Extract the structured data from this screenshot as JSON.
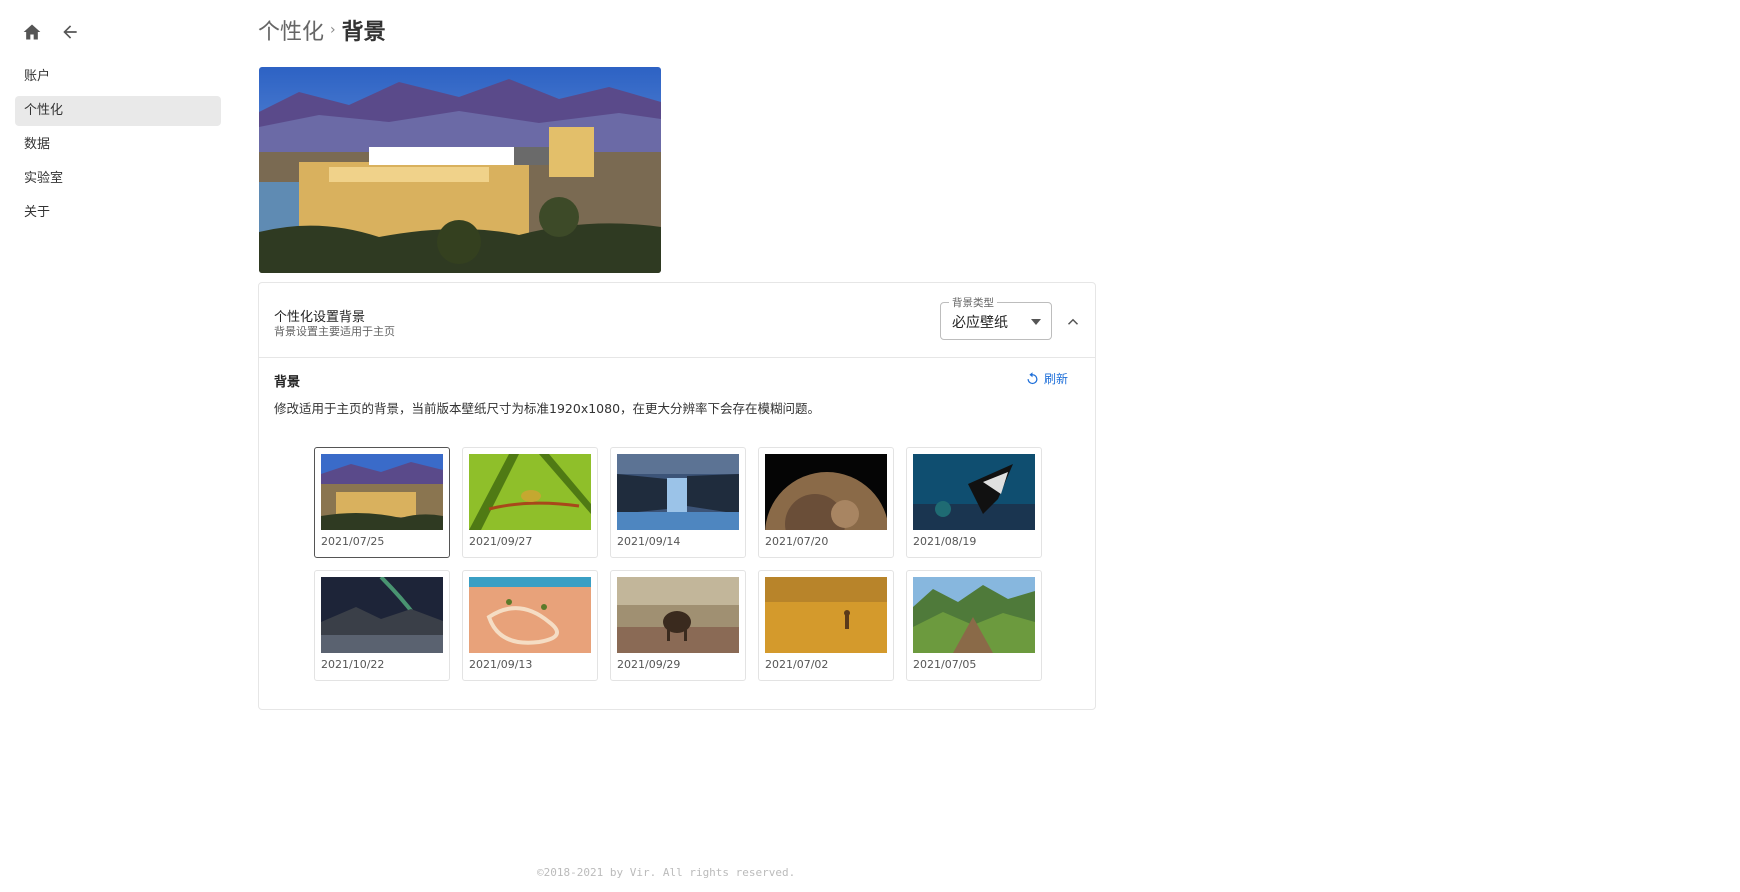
{
  "sidebar": {
    "icons": [
      "home-icon",
      "arrow-left-icon"
    ],
    "items": [
      {
        "label": "账户",
        "active": false
      },
      {
        "label": "个性化",
        "active": true
      },
      {
        "label": "数据",
        "active": false
      },
      {
        "label": "实验室",
        "active": false
      },
      {
        "label": "关于",
        "active": false
      }
    ]
  },
  "breadcrumb": {
    "parent": "个性化",
    "separator": "›",
    "current": "背景"
  },
  "settings": {
    "title": "个性化设置背景",
    "subtitle": "背景设置主要适用于主页",
    "select": {
      "label": "背景类型",
      "value": "必应壁纸"
    },
    "collapse_icon": "chevron-up-icon"
  },
  "background": {
    "title": "背景",
    "refresh_label": "刷新",
    "refresh_icon": "refresh-icon",
    "description": "修改适用于主页的背景，当前版本壁纸尺寸为标准1920x1080，在更大分辨率下会存在模糊问题。"
  },
  "thumbnails": [
    {
      "date": "2021/07/25",
      "selected": true
    },
    {
      "date": "2021/09/27",
      "selected": false
    },
    {
      "date": "2021/09/14",
      "selected": false
    },
    {
      "date": "2021/07/20",
      "selected": false
    },
    {
      "date": "2021/08/19",
      "selected": false
    },
    {
      "date": "2021/10/22",
      "selected": false
    },
    {
      "date": "2021/09/13",
      "selected": false
    },
    {
      "date": "2021/09/29",
      "selected": false
    },
    {
      "date": "2021/07/02",
      "selected": false
    },
    {
      "date": "2021/07/05",
      "selected": false
    }
  ],
  "footer": "©2018-2021 by Vir. All rights reserved.",
  "colors": {
    "accent": "#1e6fd9",
    "active_nav_bg": "#e9e9e9",
    "border": "#e6e6e6"
  }
}
